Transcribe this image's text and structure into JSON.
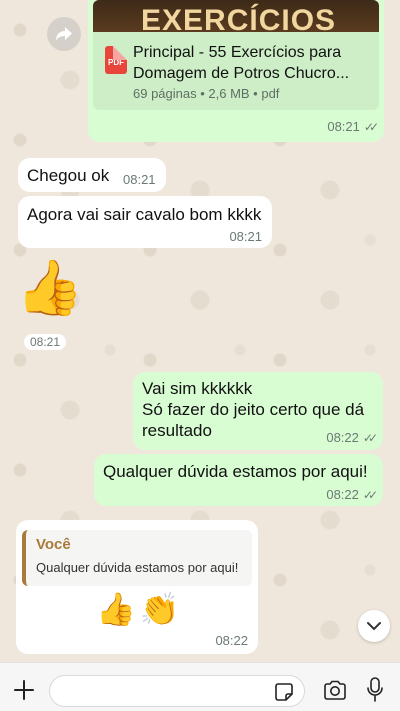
{
  "document_message": {
    "thumbnail_text": "EXERCÍCIOS",
    "file_type_badge": "PDF",
    "title": "Principal - 55 Exercícios para Domagem de Potros Chucro...",
    "meta": "69 páginas • 2,6 MB • pdf",
    "time": "08:21",
    "status": "read"
  },
  "messages": [
    {
      "direction": "in",
      "text": "Chegou ok",
      "time": "08:21"
    },
    {
      "direction": "in",
      "text": "Agora vai sair cavalo bom kkkk",
      "time": "08:21"
    },
    {
      "direction": "in",
      "emoji": "👍",
      "time": "08:21"
    },
    {
      "direction": "out",
      "lines": [
        "Vai sim kkkkkk",
        "Só fazer do jeito certo que dá",
        "resultado"
      ],
      "time": "08:22",
      "status": "read"
    },
    {
      "direction": "out",
      "text": "Qualquer dúvida estamos por aqui!",
      "time": "08:22",
      "status": "read"
    },
    {
      "direction": "in",
      "reply_to": {
        "author": "Você",
        "text": "Qualquer dúvida estamos por aqui!"
      },
      "emoji": "👍👏",
      "time": "08:22"
    }
  ],
  "input_bar": {
    "placeholder": "",
    "icons": [
      "plus-icon",
      "sticker-icon",
      "camera-icon",
      "microphone-icon"
    ]
  },
  "colors": {
    "outgoing_bubble": "#d9fdd3",
    "incoming_bubble": "#ffffff",
    "reply_accent": "#a87b3c",
    "read_ticks": "#6b7a72",
    "background": "#efe7dc"
  }
}
